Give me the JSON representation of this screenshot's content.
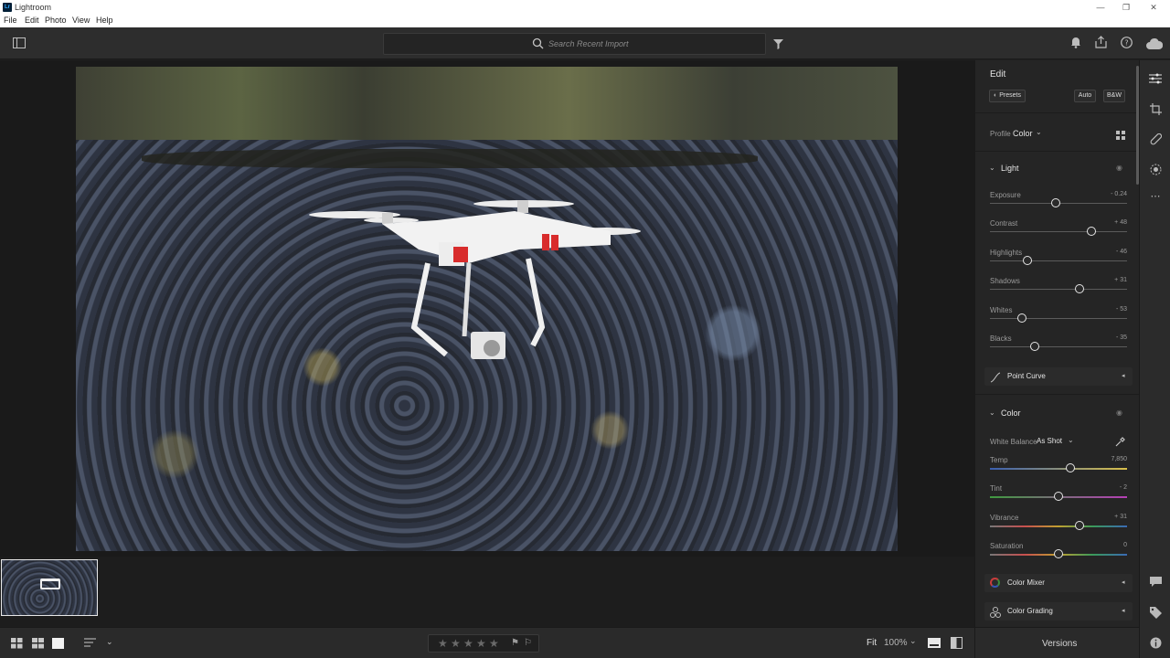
{
  "window": {
    "title": "Lightroom",
    "logo_text": "Lr",
    "controls": {
      "minimize": "—",
      "maximize": "❐",
      "close": "✕"
    }
  },
  "menu": [
    "File",
    "Edit",
    "Photo",
    "View",
    "Help"
  ],
  "toolbar": {
    "search_placeholder": "Search Recent Import",
    "icons": [
      "panel-toggle-icon",
      "search-icon",
      "filter-icon",
      "bell-icon",
      "share-icon",
      "help-icon",
      "cloud-icon"
    ]
  },
  "edit_panel": {
    "title": "Edit",
    "presets_label": "Presets",
    "auto_label": "Auto",
    "bw_label": "B&W",
    "profile_label": "Profile",
    "profile_value": "Color",
    "light": {
      "title": "Light",
      "sliders": [
        {
          "name": "Exposure",
          "value_text": "- 0.24",
          "level": 0.48
        },
        {
          "name": "Contrast",
          "value_text": "+ 48",
          "level": 0.74
        },
        {
          "name": "Highlights",
          "value_text": "- 46",
          "level": 0.27
        },
        {
          "name": "Shadows",
          "value_text": "+ 31",
          "level": 0.655
        },
        {
          "name": "Whites",
          "value_text": "- 53",
          "level": 0.235
        },
        {
          "name": "Blacks",
          "value_text": "- 35",
          "level": 0.325
        }
      ]
    },
    "point_curve_label": "Point Curve",
    "color": {
      "title": "Color",
      "white_balance_label": "White Balance",
      "white_balance_value": "As Shot",
      "sliders": [
        {
          "name": "Temp",
          "value_text": "7,850",
          "level": 0.585
        },
        {
          "name": "Tint",
          "value_text": "- 2",
          "level": 0.5
        },
        {
          "name": "Vibrance",
          "value_text": "+ 31",
          "level": 0.655
        },
        {
          "name": "Saturation",
          "value_text": "0",
          "level": 0.5
        }
      ]
    },
    "color_mixer_label": "Color Mixer",
    "color_grading_label": "Color Grading"
  },
  "bottom": {
    "fit_label": "Fit",
    "zoom_label": "100%",
    "versions_label": "Versions",
    "rating_stars": 0
  }
}
